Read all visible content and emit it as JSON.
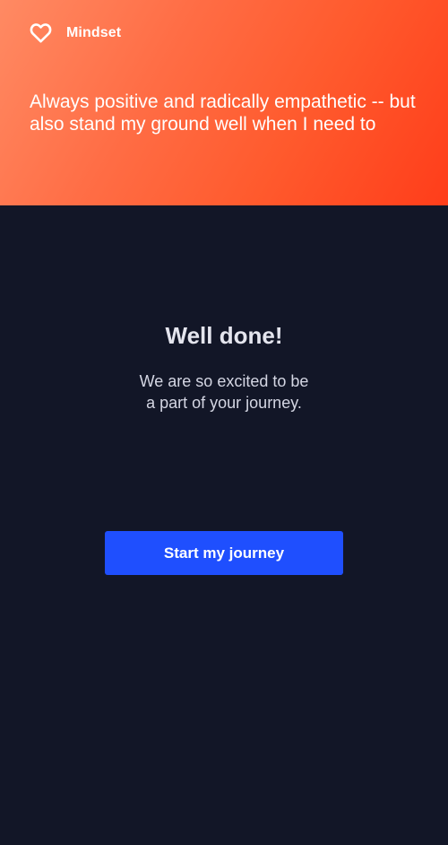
{
  "header": {
    "brand_name": "Mindset",
    "brand_icon": "heart-icon",
    "quote": "Always positive and radically empathetic -- but also stand my ground well when I need to",
    "gradient_colors": [
      "#ff8a63",
      "#ff3d1a"
    ]
  },
  "main": {
    "title": "Well done!",
    "subtitle_line_1": "We are so excited to be",
    "subtitle_line_2": "a part of your journey.",
    "cta_label": "Start my journey",
    "cta_color": "#1f4ffe",
    "background_color": "#121627"
  }
}
